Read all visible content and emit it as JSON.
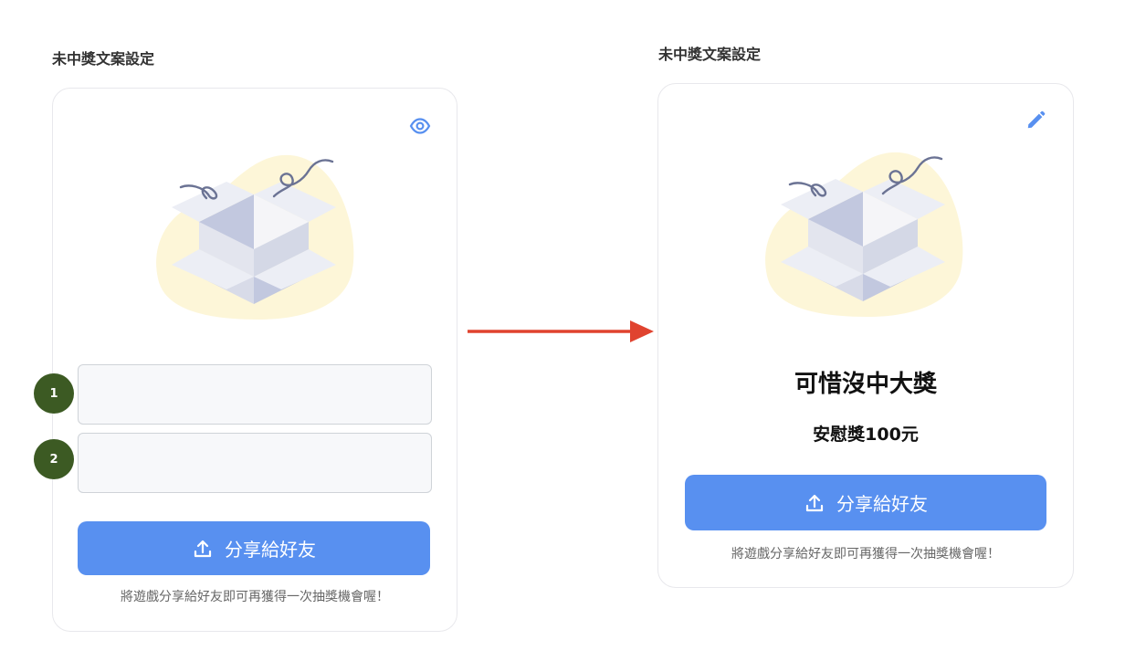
{
  "left_panel": {
    "title": "未中獎文案設定",
    "preview_icon": "eye-icon",
    "fields": [
      {
        "number": "1",
        "value": "",
        "placeholder": ""
      },
      {
        "number": "2",
        "value": "",
        "placeholder": ""
      }
    ],
    "share_button_label": "分享給好友",
    "share_icon": "upload-icon",
    "hint": "將遊戲分享給好友即可再獲得一次抽獎機會喔！"
  },
  "arrow": {
    "color": "#e0432f",
    "icon": "arrow-right-icon"
  },
  "right_panel": {
    "title": "未中獎文案設定",
    "edit_icon": "pencil-icon",
    "headline": "可惜沒中大獎",
    "subline": "安慰獎100元",
    "share_button_label": "分享給好友",
    "share_icon": "upload-icon",
    "hint": "將遊戲分享給好友即可再獲得一次抽獎機會喔！"
  },
  "colors": {
    "accent": "#5890f0",
    "badge": "#3c5a23",
    "blob": "#fdf6d8",
    "box_light": "#eceef5",
    "box_mid": "#c2c8df"
  },
  "illustration": "open-gift-box-illustration"
}
